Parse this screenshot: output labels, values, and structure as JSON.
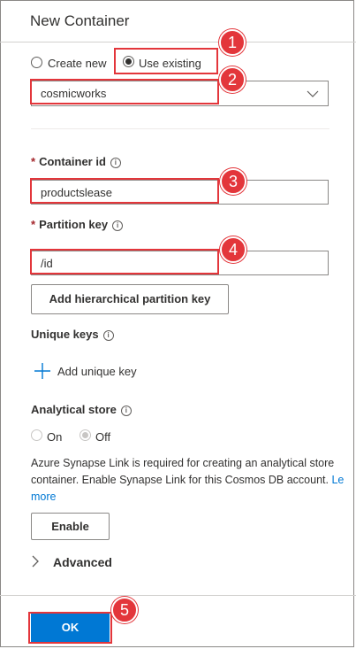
{
  "panel": {
    "title": "New Container"
  },
  "database": {
    "create_new_label": "Create new",
    "use_existing_label": "Use existing",
    "selected": "cosmicworks"
  },
  "container_id": {
    "label": "Container id",
    "value": "productslease"
  },
  "partition_key": {
    "label": "Partition key",
    "value": "/id"
  },
  "hierarchical_button": "Add hierarchical partition key",
  "unique_keys": {
    "label": "Unique keys",
    "add_label": "Add unique key"
  },
  "analytical_store": {
    "label": "Analytical store",
    "on_label": "On",
    "off_label": "Off",
    "note_line1": "Azure Synapse Link is required for creating an analytical store",
    "note_line2_text": "container. Enable Synapse Link for this Cosmos DB account. ",
    "note_link_part": "Le",
    "note_link_line2": "more",
    "enable_button": "Enable"
  },
  "advanced_label": "Advanced",
  "ok_button": "OK",
  "callouts": [
    "1",
    "2",
    "3",
    "4",
    "5"
  ],
  "colors": {
    "accent": "#0078d4",
    "callout": "#e3363b"
  }
}
